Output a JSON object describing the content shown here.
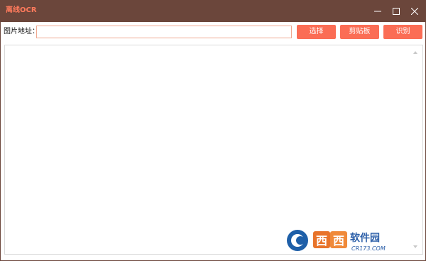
{
  "window": {
    "title": "离线OCR"
  },
  "colors": {
    "titlebar": "#6b463b",
    "title_text": "#ff7a5c",
    "accent_button": "#fb6d55",
    "input_border": "#f0a890"
  },
  "toolbar": {
    "url_label": "图片地址：",
    "url_value": "",
    "select_label": "选择",
    "clipboard_label": "剪贴板",
    "recognize_label": "识别"
  },
  "result": {
    "text": ""
  },
  "watermark": {
    "brand": "西西软件园",
    "site": "CR173.COM"
  },
  "icons": {
    "minimize": "minimize-icon",
    "maximize": "maximize-icon",
    "close": "close-icon",
    "scroll_up": "scroll-up-arrow-icon",
    "scroll_down": "scroll-down-arrow-icon"
  }
}
